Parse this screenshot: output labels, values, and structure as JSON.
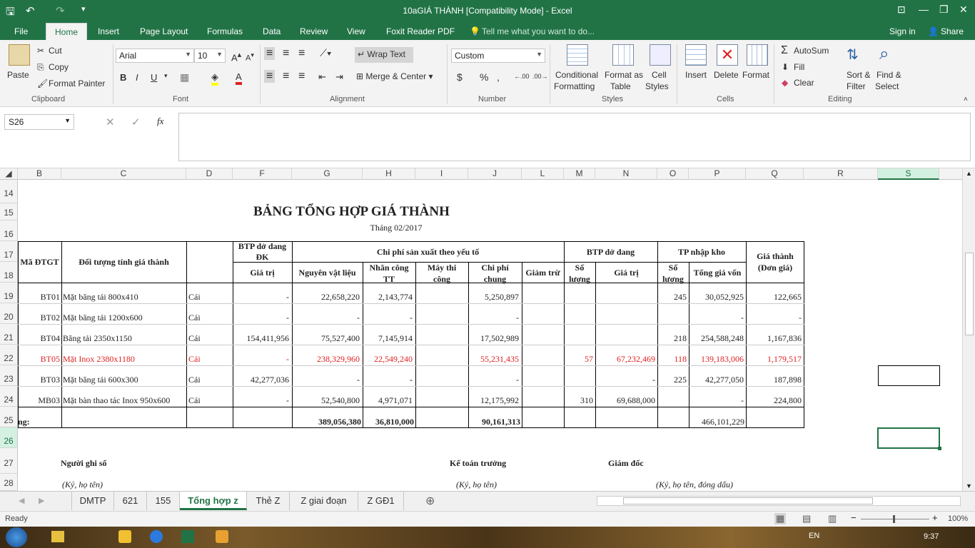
{
  "window": {
    "title": "10aGIÁ THÀNH  [Compatibility Mode] - Excel",
    "controls": [
      "⊡",
      "—",
      "❐",
      "✕"
    ]
  },
  "ribbon_tabs": [
    "File",
    "Home",
    "Insert",
    "Page Layout",
    "Formulas",
    "Data",
    "Review",
    "View",
    "Foxit Reader PDF"
  ],
  "tell_me": "Tell me what you want to do...",
  "account": {
    "signin": "Sign in",
    "share": "Share"
  },
  "ribbon": {
    "clipboard": {
      "paste": "Paste",
      "cut": "Cut",
      "copy": "Copy",
      "format_painter": "Format Painter",
      "group": "Clipboard"
    },
    "font": {
      "name": "Arial",
      "size": "10",
      "group": "Font",
      "bold": "B",
      "italic": "I",
      "underline": "U"
    },
    "alignment": {
      "wrap": "Wrap Text",
      "merge": "Merge & Center",
      "group": "Alignment"
    },
    "number": {
      "format": "Custom",
      "currency": "$",
      "percent": "%",
      "comma": ",",
      "group": "Number"
    },
    "styles": {
      "conditional": [
        "Conditional",
        "Formatting"
      ],
      "format_table": [
        "Format as",
        "Table"
      ],
      "cell_styles": [
        "Cell",
        "Styles"
      ],
      "group": "Styles"
    },
    "cells": {
      "insert": "Insert",
      "delete": "Delete",
      "format": "Format",
      "group": "Cells"
    },
    "editing": {
      "autosum": "AutoSum",
      "fill": "Fill",
      "clear": "Clear",
      "sort": [
        "Sort &",
        "Filter"
      ],
      "find": [
        "Find &",
        "Select"
      ],
      "group": "Editing"
    }
  },
  "formula_bar": {
    "namebox": "S26",
    "fx": "fx",
    "value": ""
  },
  "columns": [
    "B",
    "C",
    "D",
    "F",
    "G",
    "H",
    "I",
    "J",
    "L",
    "M",
    "N",
    "O",
    "P",
    "Q",
    "R",
    "S"
  ],
  "rows": [
    "14",
    "15",
    "16",
    "17",
    "18",
    "19",
    "20",
    "21",
    "22",
    "23",
    "24",
    "25",
    "26",
    "27",
    "28"
  ],
  "sheet": {
    "title": "BẢNG TỔNG HỢP GIÁ THÀNH",
    "subtitle": "Tháng 02/2017",
    "headers": {
      "ma": "Mã ĐTGT",
      "doituong": "Đối tượng tính giá thành",
      "btp_dk": [
        "BTP dở dang",
        "ĐK"
      ],
      "gia_tri": "Giá trị",
      "chiphi": "Chi phí sản xuất theo yếu tố",
      "nvl": "Nguyên vật liệu",
      "nctt": [
        "Nhân công",
        "TT"
      ],
      "mtc": [
        "Máy thi",
        "công"
      ],
      "cpc": [
        "Chi phí",
        "chung"
      ],
      "giamtru": "Giảm trừ",
      "btp": "BTP dở dang",
      "so_luong": [
        "Số",
        "lượng"
      ],
      "gia_tri2": "Giá trị",
      "tp": "TP nhập kho",
      "so_luong2": [
        "Số",
        "lượng"
      ],
      "tong": "Tổng giá vốn",
      "gia_thanh": [
        "Giá thành",
        "(Đơn giá)"
      ]
    },
    "rows": [
      {
        "ma": "BT01",
        "ten": "Mặt băng tải 800x410",
        "dvt": "Cái",
        "dk": "-",
        "nvl": "22,658,220",
        "nc": "2,143,774",
        "mtc": "",
        "cpc": "5,250,897",
        "gt": "",
        "sl": "",
        "gtr": "",
        "sl2": "245",
        "tong": "30,052,925",
        "gia": "122,665",
        "red": false
      },
      {
        "ma": "BT02",
        "ten": "Mặt băng tải 1200x600",
        "dvt": "Cái",
        "dk": "-",
        "nvl": "-",
        "nc": "-",
        "mtc": "",
        "cpc": "-",
        "gt": "",
        "sl": "",
        "gtr": "",
        "sl2": "",
        "tong": "-",
        "gia": "-",
        "red": false
      },
      {
        "ma": "BT04",
        "ten": "Băng tải 2350x1150",
        "dvt": "Cái",
        "dk": "154,411,956",
        "nvl": "75,527,400",
        "nc": "7,145,914",
        "mtc": "",
        "cpc": "17,502,989",
        "gt": "",
        "sl": "",
        "gtr": "",
        "sl2": "218",
        "tong": "254,588,248",
        "gia": "1,167,836",
        "red": false
      },
      {
        "ma": "BT05",
        "ten": "Mặt Inox 2380x1180",
        "dvt": "Cái",
        "dk": "-",
        "nvl": "238,329,960",
        "nc": "22,549,240",
        "mtc": "",
        "cpc": "55,231,435",
        "gt": "",
        "sl": "57",
        "gtr": "67,232,469",
        "sl2": "118",
        "tong": "139,183,006",
        "gia": "1,179,517",
        "red": true
      },
      {
        "ma": "BT03",
        "ten": "Mặt băng tải 600x300",
        "dvt": "Cái",
        "dk": "42,277,036",
        "nvl": "-",
        "nc": "-",
        "mtc": "",
        "cpc": "-",
        "gt": "",
        "sl": "",
        "gtr": "-",
        "sl2": "225",
        "tong": "42,277,050",
        "gia": "187,898",
        "red": false
      },
      {
        "ma": "MB03",
        "ten": "Mặt bàn thao tác Inox 950x600",
        "dvt": "Cái",
        "dk": "-",
        "nvl": "52,540,800",
        "nc": "4,971,071",
        "mtc": "",
        "cpc": "12,175,992",
        "gt": "",
        "sl": "310",
        "gtr": "69,688,000",
        "sl2": "",
        "tong": "-",
        "gia": "224,800",
        "red": false
      }
    ],
    "total": {
      "label": "ng:",
      "nvl": "389,056,380",
      "nc": "36,810,000",
      "cpc": "90,161,313",
      "tong": "466,101,229"
    },
    "signatures": {
      "nguoighi": "Người ghi sổ",
      "ketoan": "Kế toán trưởng",
      "giamdoc": "Giám đốc",
      "ky1": "(Ký, họ tên)",
      "ky2": "(Ký, họ tên)",
      "ky3": "(Ký, họ tên, đóng dấu)"
    }
  },
  "sheet_tabs": [
    "DMTP",
    "621",
    "155",
    "Tổng hợp z",
    "Thẻ Z",
    "Z giai đoạn",
    "Z GĐ1"
  ],
  "status": {
    "ready": "Ready",
    "zoom": "100%"
  },
  "taskbar": {
    "lang": "EN",
    "time": "9:37"
  }
}
